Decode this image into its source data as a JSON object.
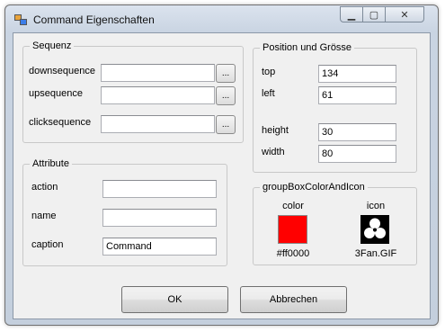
{
  "window": {
    "title": "Command Eigenschaften",
    "minimize_symbol": "▁",
    "maximize_symbol": "▢",
    "close_symbol": "✕"
  },
  "sequenz": {
    "title": "Sequenz",
    "down_label": "downsequence",
    "down_value": "",
    "up_label": "upsequence",
    "up_value": "",
    "click_label": "clicksequence",
    "click_value": "",
    "browse_label": "..."
  },
  "attribute": {
    "title": "Attribute",
    "action_label": "action",
    "action_value": "",
    "name_label": "name",
    "name_value": "",
    "caption_label": "caption",
    "caption_value": "Command"
  },
  "position": {
    "title": "Position und Grösse",
    "top_label": "top",
    "top_value": "134",
    "left_label": "left",
    "left_value": "61",
    "height_label": "height",
    "height_value": "30",
    "width_label": "width",
    "width_value": "80"
  },
  "color_icon": {
    "title": "groupBoxColorAndIcon",
    "color_label": "color",
    "color_value": "#ff0000",
    "swatch_color": "#ff0000",
    "icon_label": "icon",
    "icon_name": "three-blade-fan-icon",
    "icon_file": "3Fan.GIF"
  },
  "buttons": {
    "ok_label": "OK",
    "cancel_label": "Abbrechen"
  }
}
